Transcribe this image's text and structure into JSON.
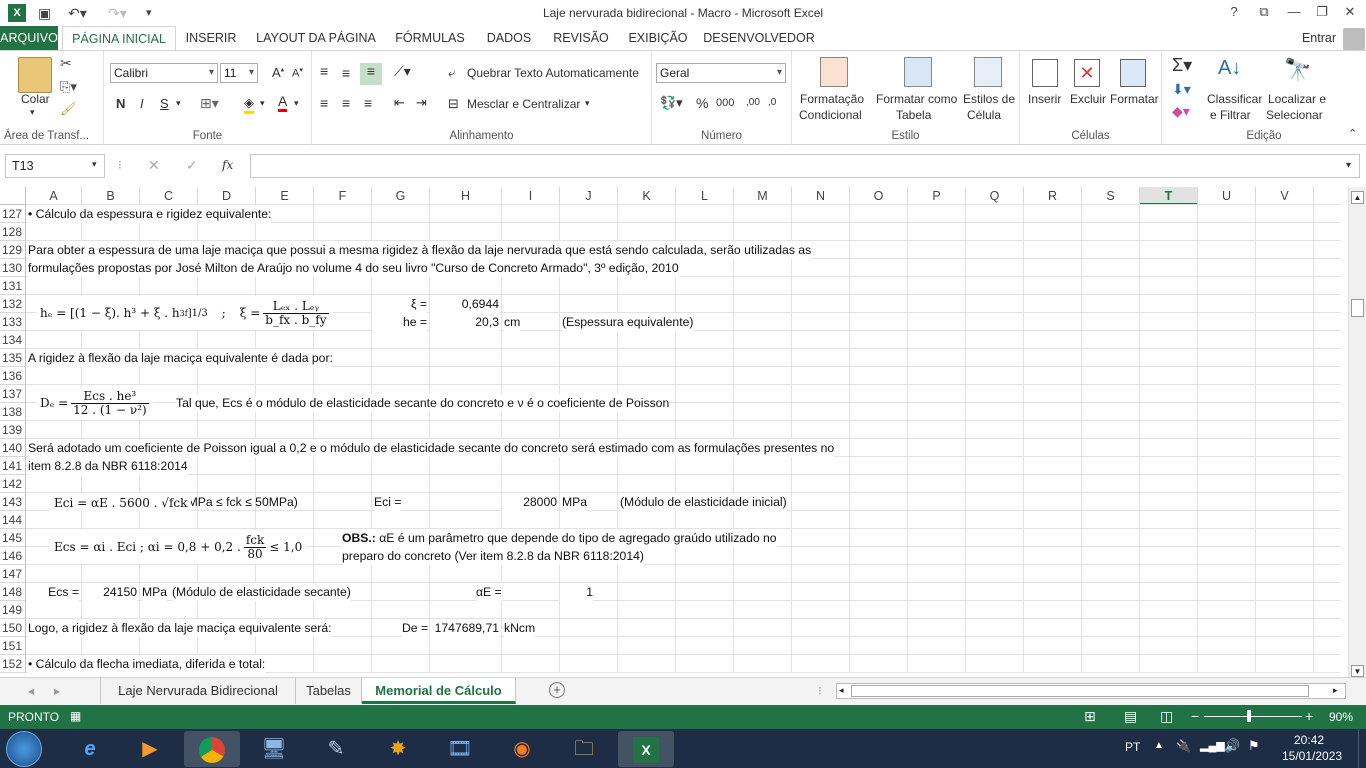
{
  "window": {
    "title": "Laje nervurada bidirecional - Macro - Microsoft Excel",
    "help": "?",
    "user": "Entrar"
  },
  "tabs": [
    "ARQUIVO",
    "PÁGINA INICIAL",
    "INSERIR",
    "LAYOUT DA PÁGINA",
    "FÓRMULAS",
    "DADOS",
    "REVISÃO",
    "EXIBIÇÃO",
    "DESENVOLVEDOR"
  ],
  "ribbon": {
    "clipboard": {
      "label": "Área de Transf...",
      "paste": "Colar"
    },
    "font": {
      "label": "Fonte",
      "name": "Calibri",
      "size": "11",
      "bold": "N",
      "italic": "I",
      "underline": "S"
    },
    "alignment": {
      "label": "Alinhamento",
      "wrap": "Quebrar Texto Automaticamente",
      "merge": "Mesclar e Centralizar"
    },
    "number": {
      "label": "Número",
      "format": "Geral"
    },
    "styles": {
      "label": "Estilo",
      "cond1": "Formatação",
      "cond2": "Condicional",
      "table1": "Formatar como",
      "table2": "Tabela",
      "cell1": "Estilos de",
      "cell2": "Célula"
    },
    "cells": {
      "label": "Células",
      "insert": "Inserir",
      "delete": "Excluir",
      "format": "Formatar"
    },
    "editing": {
      "label": "Edição",
      "sort1": "Classificar",
      "sort2": "e Filtrar",
      "find1": "Localizar e",
      "find2": "Selecionar"
    }
  },
  "formula_bar": {
    "name_box": "T13",
    "fx": "fx",
    "content": ""
  },
  "columns": [
    "A",
    "B",
    "C",
    "D",
    "E",
    "F",
    "G",
    "H",
    "I",
    "J",
    "K",
    "L",
    "M",
    "N",
    "O",
    "P",
    "Q",
    "R",
    "S",
    "T",
    "U",
    "V"
  ],
  "selected_column": "T",
  "rows": [
    "127",
    "128",
    "129",
    "130",
    "131",
    "132",
    "133",
    "134",
    "135",
    "136",
    "137",
    "138",
    "139",
    "140",
    "141",
    "142",
    "143",
    "144",
    "145",
    "146",
    "147",
    "148",
    "149",
    "150",
    "151",
    "152"
  ],
  "cells": {
    "r127": "• Cálculo da espessura e rigidez equivalente:",
    "r129": "Para obter a espessura de uma laje maciça que possui a mesma rigidez à flexão da laje nervurada que está sendo calculada, serão utilizadas as",
    "r130": "formulações propostas por José Milton de Araújo no volume 4 do seu livro \"Curso de Concreto Armado\", 3º edição, 2010",
    "xi_label": "ξ =",
    "xi_value": "0,6944",
    "he_label": "he =",
    "he_value": "20,3",
    "he_unit": "cm",
    "he_note": "(Espessura equivalente)",
    "r135": "A rigidez à flexão da laje maciça equivalente é dada por:",
    "r137": "Tal que, Ecs é o módulo de elasticidade secante do concreto e ν é o coeficiente de Poisson",
    "r140": "Será adotado um coeficiente de Poisson igual a 0,2 e o módulo de elasticidade secante do concreto será estimado com as formulações presentes no",
    "r141": "item 8.2.8 da NBR 6118:2014",
    "eci_range": "(20MPa ≤ fck ≤ 50MPa)",
    "eci_label": "Eci =",
    "eci_value": "28000",
    "eci_unit": "MPa",
    "eci_note": "(Módulo de elasticidade inicial)",
    "obs_bold": "OBS.:",
    "obs_1": "αE é um parâmetro que depende do tipo de agregado graúdo utilizado no",
    "obs_2": "preparo do concreto (Ver item 8.2.8 da NBR 6118:2014)",
    "ecs_label": "Ecs =",
    "ecs_value": "24150",
    "ecs_unit": "MPa",
    "ecs_note": "(Módulo de elasticidade secante)",
    "ae_label": "αE =",
    "ae_value": "1",
    "r150": "Logo, a rigidez à flexão da laje maciça equivalente será:",
    "de_label": "De =",
    "de_value": "1747689,71",
    "de_unit": "kNcm",
    "r152": "• Cálculo da flecha imediata, diferida e total:"
  },
  "formulas": {
    "he_lhs": "hₑ = [(1 − ξ). h³ + ξ . h",
    "he_sub": "f",
    "he_sup3": "3",
    "he_exp": "]1/3",
    "sep": ";",
    "xi_lhs": "ξ =",
    "xi_num": "Lₑₓ . Lₑᵧ",
    "xi_den": "b_fx . b_fy",
    "de_lhs": "Dₑ =",
    "de_num": "Ecs . he³",
    "de_den": "12 . (1 − ν²)",
    "eci_f": "Eci = αE . 5600 . √fck",
    "ecs_f1": "Ecs = αi . Eci  ;  αi = 0,8 + 0,2 .",
    "ecs_num": "fck",
    "ecs_den": "80",
    "ecs_f2": "≤ 1,0"
  },
  "sheets": [
    "Laje Nervurada Bidirecional",
    "Tabelas",
    "Memorial de Cálculo"
  ],
  "active_sheet": "Memorial de Cálculo",
  "status": {
    "mode": "PRONTO",
    "zoom": "90%"
  },
  "taskbar": {
    "lang": "PT",
    "time": "20:42",
    "date": "15/01/2023"
  }
}
